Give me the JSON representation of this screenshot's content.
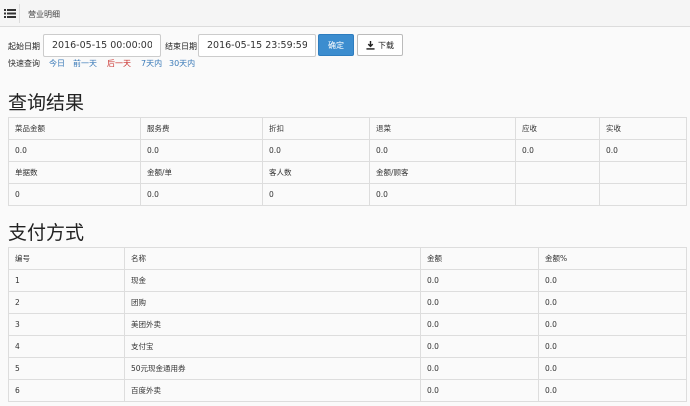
{
  "topbar": {
    "title": "营业明细",
    "menu_icon": "list-icon"
  },
  "filters": {
    "start_label": "起始日期",
    "start_value": "2016-05-15 00:00:00",
    "end_label": "结束日期",
    "end_value": "2016-05-15 23:59:59",
    "confirm_label": "确定",
    "download_label": "下载",
    "quick_label": "快速查询",
    "quick_links": [
      "今日",
      "前一天",
      "后一天",
      "7天内",
      "30天内"
    ]
  },
  "results": {
    "title": "查询结果",
    "row1_headers": [
      "菜品金额",
      "服务费",
      "折扣",
      "退菜",
      "应收",
      "实收"
    ],
    "row1_values": [
      "0.0",
      "0.0",
      "0.0",
      "0.0",
      "0.0",
      "0.0"
    ],
    "row2_headers": [
      "单据数",
      "金额/单",
      "客人数",
      "金额/顾客",
      "",
      ""
    ],
    "row2_values": [
      "0",
      "0.0",
      "0",
      "0.0",
      "",
      ""
    ]
  },
  "payments": {
    "title": "支付方式",
    "headers": [
      "编号",
      "名称",
      "金额",
      "金额%"
    ],
    "rows": [
      [
        "1",
        "现金",
        "0.0",
        "0.0"
      ],
      [
        "2",
        "团购",
        "0.0",
        "0.0"
      ],
      [
        "3",
        "美团外卖",
        "0.0",
        "0.0"
      ],
      [
        "4",
        "支付宝",
        "0.0",
        "0.0"
      ],
      [
        "5",
        "50元现金通用券",
        "0.0",
        "0.0"
      ],
      [
        "6",
        "百度外卖",
        "0.0",
        "0.0"
      ]
    ]
  }
}
